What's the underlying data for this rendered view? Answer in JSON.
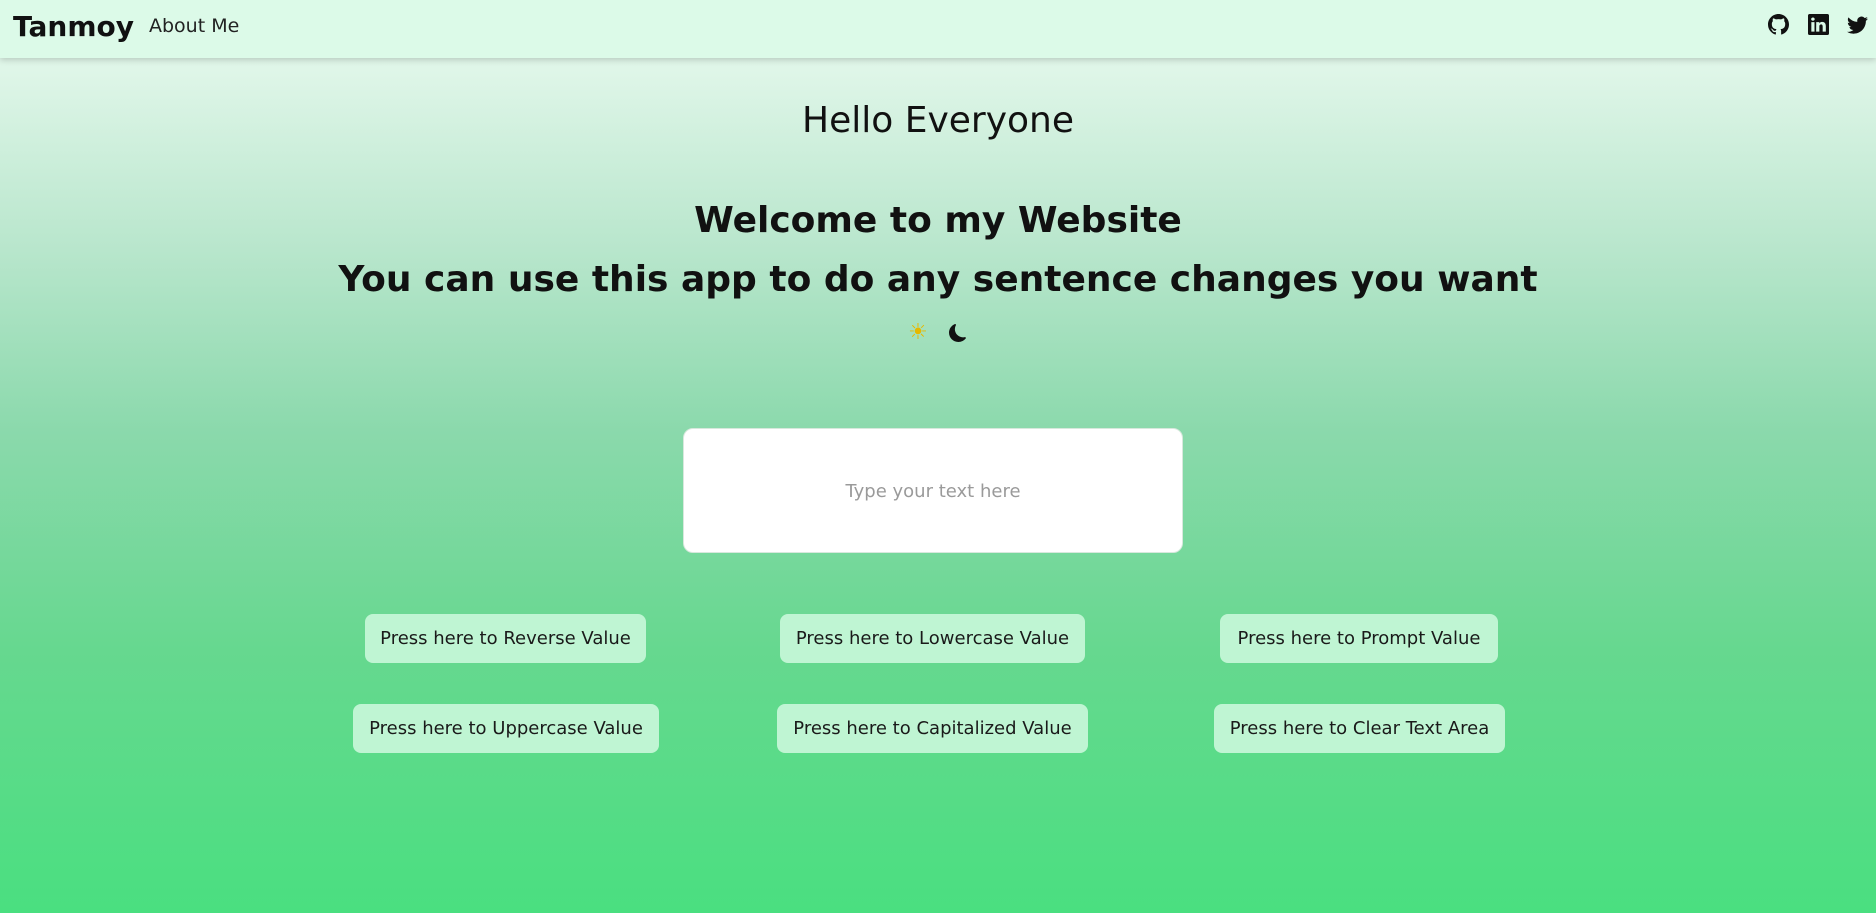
{
  "navbar": {
    "brand": "Tanmoy",
    "links": [
      {
        "label": "About Me"
      }
    ],
    "social_icons": [
      "github-icon",
      "linkedin-icon",
      "twitter-icon"
    ]
  },
  "hero": {
    "greeting": "Hello Everyone",
    "welcome": "Welcome to my Website",
    "subtitle": "You can use this app to do any sentence changes you want",
    "theme_icons": [
      "sun-icon",
      "moon-icon"
    ]
  },
  "editor": {
    "placeholder": "Type your text here",
    "value": ""
  },
  "actions": {
    "reverse": "Press here to Reverse Value",
    "lowercase": "Press here to Lowercase Value",
    "prompt": "Press here to Prompt Value",
    "uppercase": "Press here to Uppercase Value",
    "capitalized": "Press here to Capitalized Value",
    "clear": "Press here to Clear Text Area"
  },
  "colors": {
    "navbar_bg": "#dcfae8",
    "button_bg": "#bff5d3",
    "gradient_top": "#e2f7ea",
    "gradient_bottom": "#4adf80",
    "sun": "#e6b800"
  }
}
